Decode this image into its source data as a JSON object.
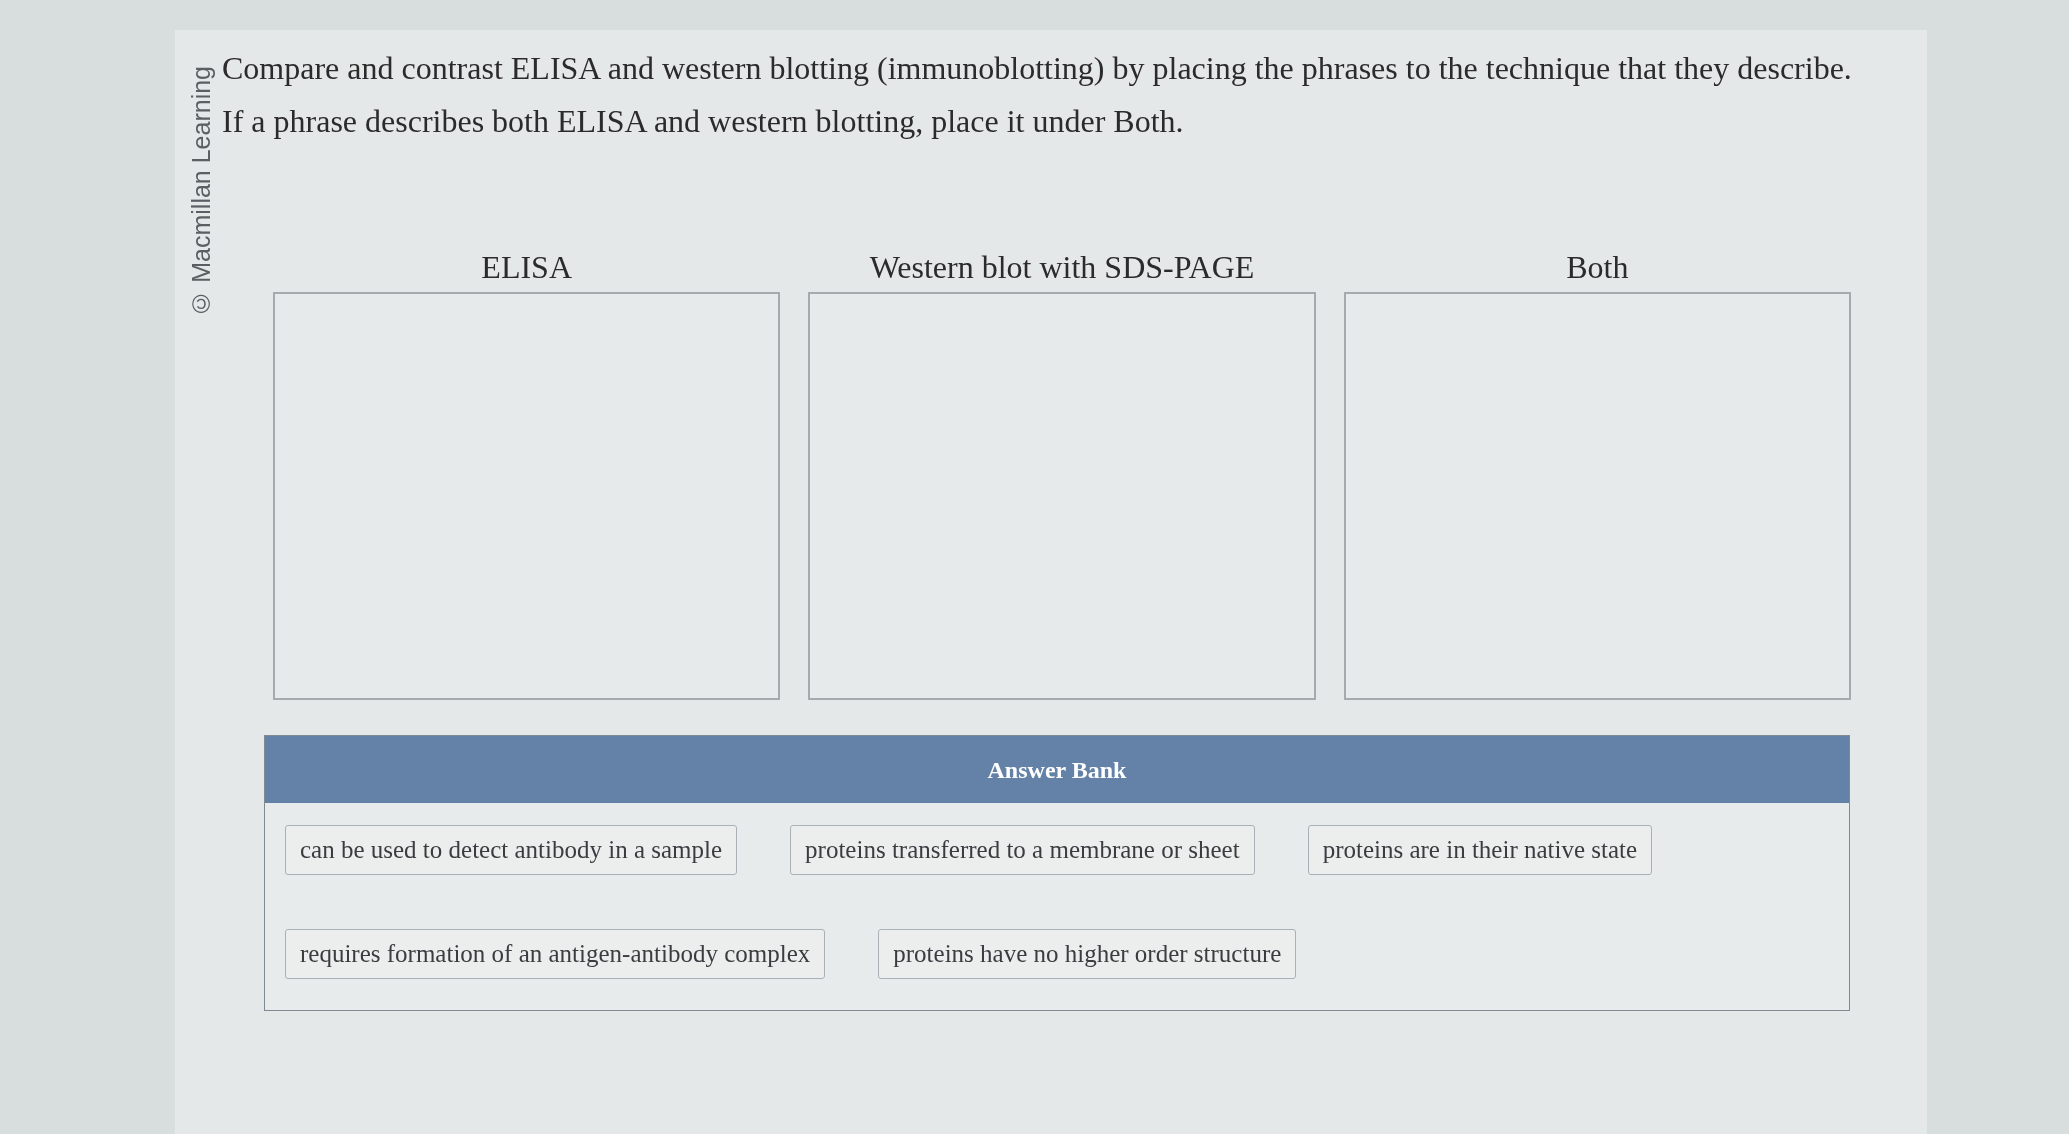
{
  "copyright": "© Macmillan Learning",
  "instructions": [
    "Compare and contrast ELISA and western blotting (immunoblotting) by placing the phrases to the technique that they describe.",
    "If a phrase describes both ELISA and western blotting, place it under Both."
  ],
  "columns": [
    {
      "heading": "ELISA"
    },
    {
      "heading": "Western blot with SDS-PAGE"
    },
    {
      "heading": "Both"
    }
  ],
  "answer_bank": {
    "title": "Answer Bank",
    "phrases": [
      "can be used to detect antibody in a sample",
      "proteins transferred to a membrane or sheet",
      "proteins are in their native state",
      "requires formation of an antigen-antibody complex",
      "proteins have no higher order structure"
    ]
  }
}
